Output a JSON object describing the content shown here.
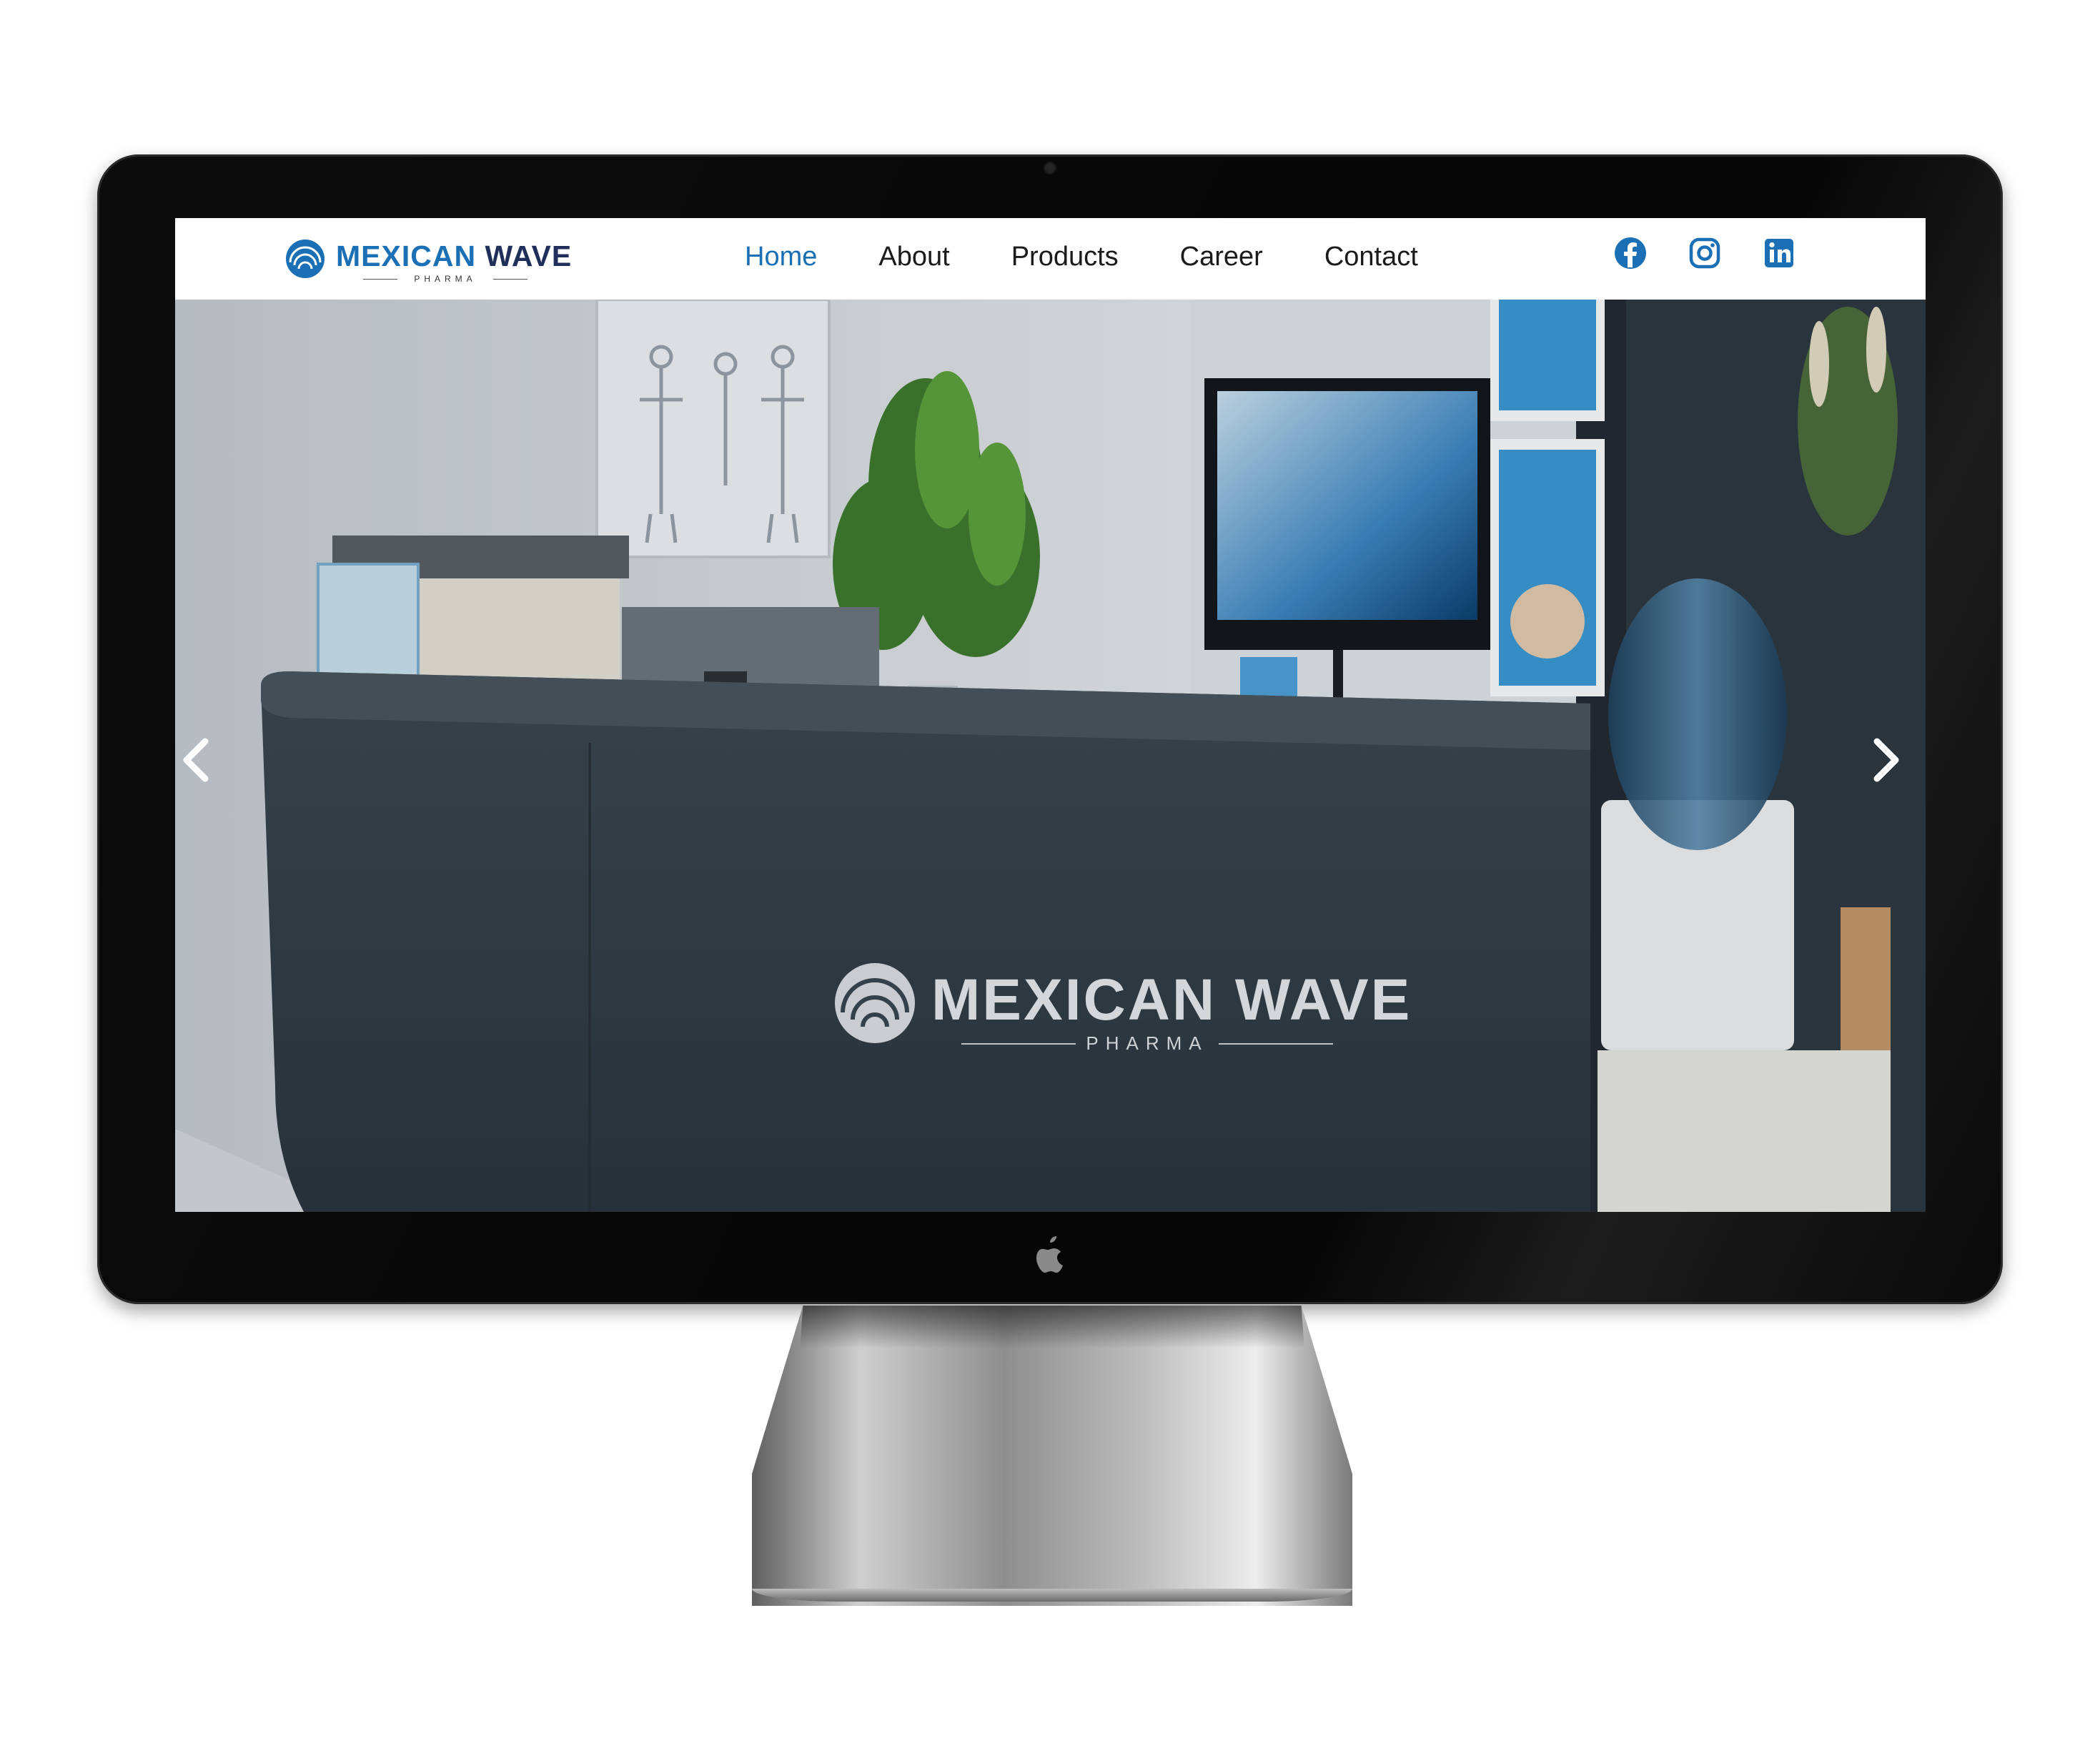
{
  "site": {
    "logo": {
      "word_a": "MEX",
      "word_b": "I",
      "word_c": "CAN",
      "word_d": " WAVE",
      "tagline": "PHARMA"
    },
    "nav": [
      {
        "label": "Home",
        "active": true
      },
      {
        "label": "About",
        "active": false
      },
      {
        "label": "Products",
        "active": false
      },
      {
        "label": "Career",
        "active": false
      },
      {
        "label": "Contact",
        "active": false
      }
    ],
    "social": [
      "facebook-icon",
      "instagram-icon",
      "linkedin-icon"
    ],
    "accent_color": "#1a6fb5"
  },
  "hero": {
    "desk_sign": {
      "word": "MEXICAN WAVE",
      "tagline": "PHARMA"
    },
    "prev_icon": "chevron-left-icon",
    "next_icon": "chevron-right-icon"
  },
  "device": {
    "logo_icon": "apple-icon"
  }
}
